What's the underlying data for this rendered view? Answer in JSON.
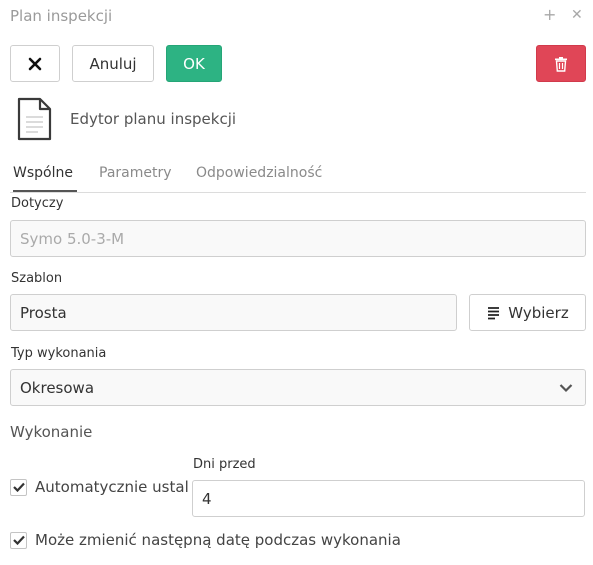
{
  "window": {
    "title": "Plan inspekcji"
  },
  "toolbar": {
    "cancel_label": "Anuluj",
    "ok_label": "OK"
  },
  "editor": {
    "title": "Edytor planu inspekcji"
  },
  "tabs": [
    {
      "label": "Wspólne",
      "active": true
    },
    {
      "label": "Parametry",
      "active": false
    },
    {
      "label": "Odpowiedzialność",
      "active": false
    }
  ],
  "form": {
    "concerns": {
      "label": "Dotyczy",
      "value": "Symo 5.0-3-M"
    },
    "template": {
      "label": "Szablon",
      "value": "Prosta",
      "select_button": "Wybierz"
    },
    "execution_type": {
      "label": "Typ wykonania",
      "value": "Okresowa"
    },
    "execution_section": "Wykonanie",
    "auto_set": {
      "label": "Automatycznie ustal",
      "checked": true
    },
    "days_before": {
      "label": "Dni przed",
      "value": "4"
    },
    "can_change_date": {
      "label": "Może zmienić następną datę podczas wykonania",
      "checked": true
    }
  },
  "colors": {
    "ok": "#2db383",
    "delete": "#e04657",
    "tab_underline": "#555555"
  },
  "icons": [
    "plus-icon",
    "close-icon",
    "x-icon",
    "trash-icon",
    "document-icon",
    "list-icon",
    "chevron-down-icon",
    "checkmark-icon"
  ]
}
